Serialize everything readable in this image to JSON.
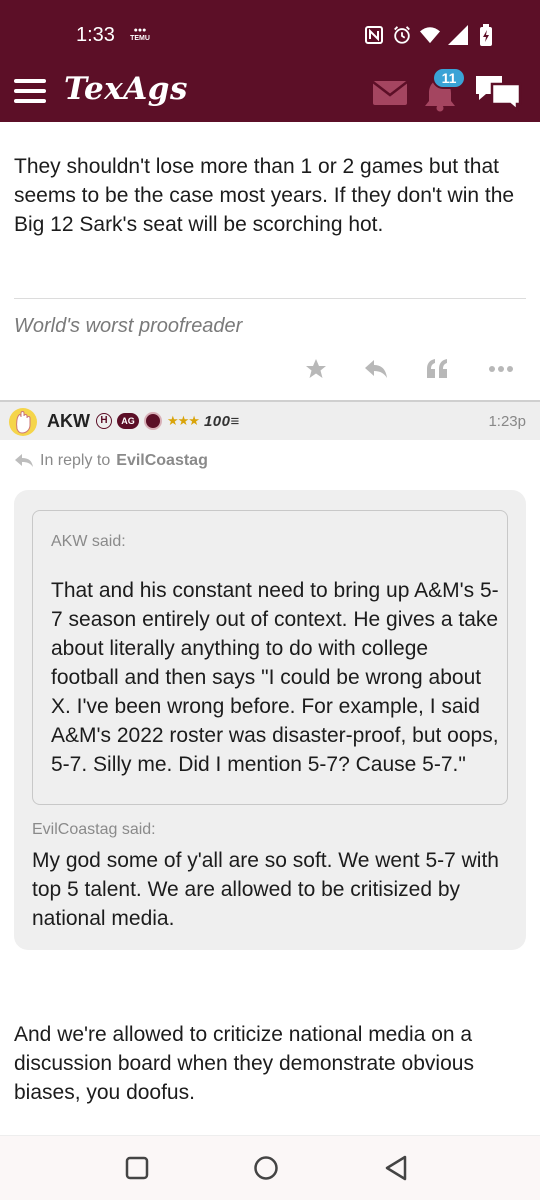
{
  "status_bar": {
    "time": "1:33",
    "temu_label": "TEMU",
    "icons": [
      "nfc-icon",
      "alarm-icon",
      "wifi-icon",
      "signal-icon",
      "battery-icon"
    ]
  },
  "app_bar": {
    "logo_text": "TexAgs",
    "notification_count": "11",
    "brand_color": "#5c0f27",
    "badge_color": "#3aa3d6"
  },
  "previous_post": {
    "body": "They shouldn't lose more than 1 or 2 games but that seems to be the case most years. If they don't win the Big 12 Sark's seat will be scorching hot.",
    "signature": "World's worst proofreader",
    "actions": [
      "star-icon",
      "reply-icon",
      "quote-icon",
      "more-icon"
    ]
  },
  "post": {
    "username": "AKW",
    "badge_h": "H",
    "badge_ag": "AG",
    "stars": "★★★",
    "rank": "100",
    "time": "1:23p",
    "in_reply_to_prefix": "In reply to",
    "in_reply_to_user": "EvilCoastag",
    "nested_quote": {
      "said": "AKW said:",
      "text": "That and his constant need to bring up A&M's 5-7 season entirely out of context. He gives a take about literally anything to do with college football and then says \"I could be wrong about X. I've been wrong before. For example, I said A&M's 2022 roster was disaster-proof, but oops, 5-7. Silly me. Did I mention 5-7? Cause 5-7.\""
    },
    "quote": {
      "said": "EvilCoastag said:",
      "text": "My god some of y'all are so soft. We went 5-7 with top 5 talent. We are allowed to be critisized by national media."
    },
    "body": "And we're allowed to criticize national media on a discussion board when they demonstrate obvious biases, you doofus."
  },
  "nav_bar": {
    "buttons": [
      "recents-icon",
      "home-icon",
      "back-icon"
    ]
  }
}
